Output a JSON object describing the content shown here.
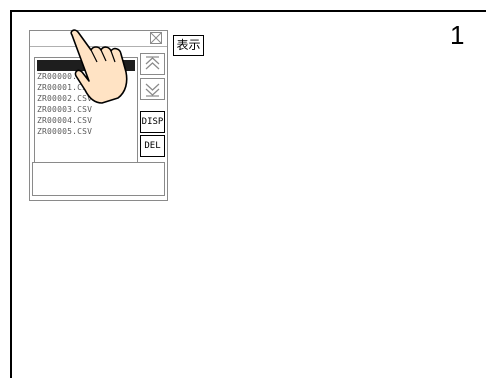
{
  "page_number": "1",
  "window": {
    "files": [
      {
        "name": "ZR00000.CSV",
        "visible_text": "ZR00000.C",
        "selected": false
      },
      {
        "name": "ZR00001.CSV",
        "visible_text": "ZR00001.CSV",
        "selected": false
      },
      {
        "name": "ZR00002.CSV",
        "visible_text": "ZR00002.CSV",
        "selected": false
      },
      {
        "name": "ZR00003.CSV",
        "visible_text": "ZR00003.CSV",
        "selected": false
      },
      {
        "name": "ZR00004.CSV",
        "visible_text": "ZR00004.CSV",
        "selected": false
      },
      {
        "name": "ZR00005.CSV",
        "visible_text": "ZR00005.CSV",
        "selected": false
      }
    ],
    "buttons": {
      "scroll_up_icon": "double-chevron-up-icon",
      "scroll_down_icon": "double-chevron-down-icon",
      "disp_label": "DISP",
      "del_label": "DEL"
    },
    "close_icon": "close-x-icon"
  },
  "display_label": "表示",
  "pointer_icon": "hand-pointer-icon"
}
